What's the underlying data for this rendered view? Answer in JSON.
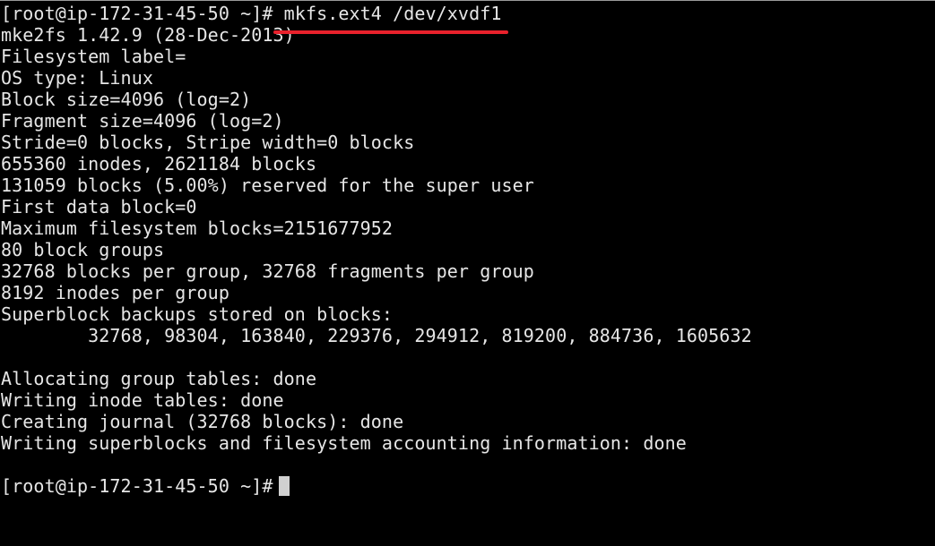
{
  "terminal": {
    "prompt": "[root@ip-172-31-45-50 ~]#",
    "command": " mkfs.ext4 /dev/xvdf1",
    "output": [
      "mke2fs 1.42.9 (28-Dec-2013)",
      "Filesystem label=",
      "OS type: Linux",
      "Block size=4096 (log=2)",
      "Fragment size=4096 (log=2)",
      "Stride=0 blocks, Stripe width=0 blocks",
      "655360 inodes, 2621184 blocks",
      "131059 blocks (5.00%) reserved for the super user",
      "First data block=0",
      "Maximum filesystem blocks=2151677952",
      "80 block groups",
      "32768 blocks per group, 32768 fragments per group",
      "8192 inodes per group",
      "Superblock backups stored on blocks:",
      "        32768, 98304, 163840, 229376, 294912, 819200, 884736, 1605632",
      "",
      "Allocating group tables: done",
      "Writing inode tables: done",
      "Creating journal (32768 blocks): done",
      "Writing superblocks and filesystem accounting information: done",
      ""
    ],
    "final_prompt": "[root@ip-172-31-45-50 ~]#",
    "colors": {
      "background": "#000000",
      "text": "#e6e6e6",
      "annotation_underline": "#e8212c",
      "cursor": "#d0d0d0"
    }
  }
}
